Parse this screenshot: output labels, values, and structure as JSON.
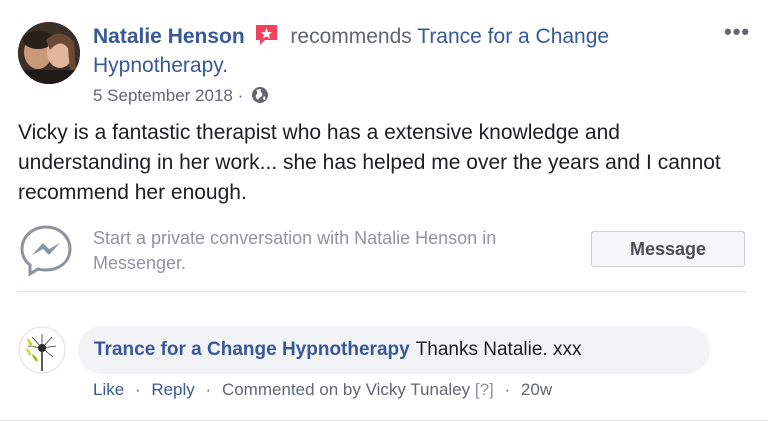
{
  "post": {
    "author": "Natalie Henson",
    "verb": "recommends",
    "page_name": "Trance for a Change Hypnotherapy.",
    "date": "5 September 2018",
    "separator": "·",
    "more_label": "•••",
    "text": "Vicky is a fantastic therapist who has a extensive knowledge and understanding in her work... she has helped me over the years and I cannot recommend her enough."
  },
  "messenger": {
    "prompt": "Start a private conversation with Natalie Henson in Messenger.",
    "button_label": "Message"
  },
  "comment": {
    "author": "Trance for a Change Hypnotherapy",
    "text": "Thanks Natalie. xxx",
    "like_label": "Like",
    "reply_label": "Reply",
    "commented_on": "Commented on by Vicky Tunaley",
    "help_label": "[?]",
    "time": "20w",
    "dot": "·"
  },
  "icons": {
    "recommend_badge": "recommendation-star-icon",
    "audience": "globe-icon",
    "messenger": "messenger-icon",
    "page_avatar": "dandelion-logo"
  },
  "colors": {
    "link": "#385898",
    "secondary": "#606770",
    "badge": "#f3425f"
  }
}
